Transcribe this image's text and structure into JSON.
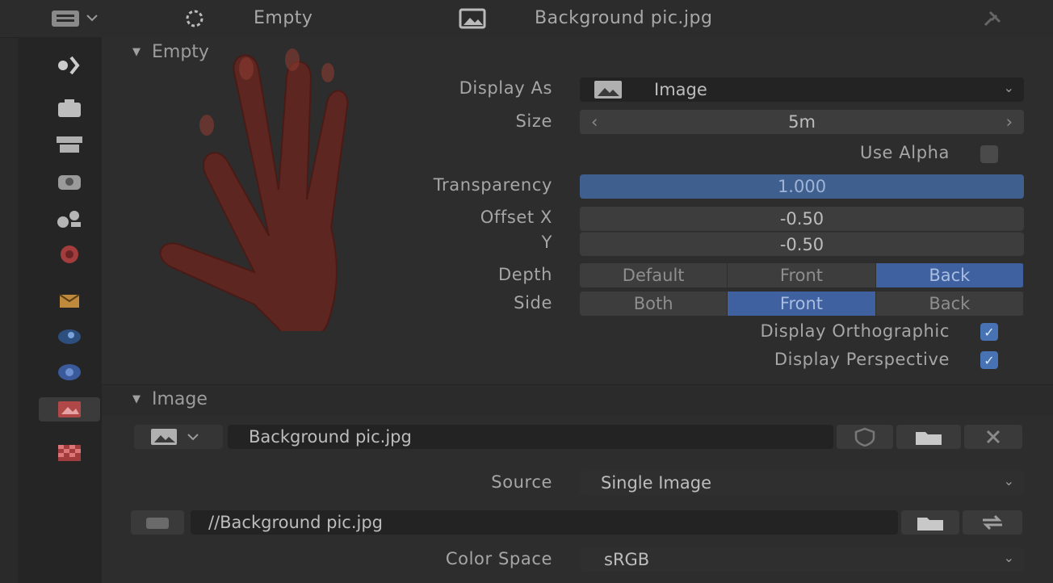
{
  "header": {
    "object_name": "Empty",
    "data_name": "Background pic.jpg"
  },
  "sidebar": {
    "icons": [
      "tool-icon",
      "render-icon",
      "output-icon",
      "view-layer-icon",
      "scene-icon",
      "world-icon",
      "object-icon",
      "modifier-icon",
      "physics-icon",
      "constraints-icon",
      "object-data-icon",
      "texture-icon"
    ],
    "active": "object-data-icon"
  },
  "empty_section": {
    "title": "Empty",
    "display_as": {
      "label": "Display As",
      "value": "Image"
    },
    "size": {
      "label": "Size",
      "value": "5m"
    },
    "use_alpha": {
      "label": "Use Alpha",
      "checked": false
    },
    "transparency": {
      "label": "Transparency",
      "value": "1.000"
    },
    "offset_x": {
      "label": "Offset X",
      "value": "-0.50"
    },
    "offset_y": {
      "label": "Y",
      "value": "-0.50"
    },
    "depth": {
      "label": "Depth",
      "options": [
        "Default",
        "Front",
        "Back"
      ],
      "selected": "Back"
    },
    "side": {
      "label": "Side",
      "options": [
        "Both",
        "Front",
        "Back"
      ],
      "selected": "Front"
    },
    "display_orthographic": {
      "label": "Display Orthographic",
      "checked": true
    },
    "display_perspective": {
      "label": "Display Perspective",
      "checked": true
    }
  },
  "image_section": {
    "title": "Image",
    "image_name": "Background pic.jpg",
    "source": {
      "label": "Source",
      "value": "Single Image"
    },
    "filepath": "//Background pic.jpg",
    "color_space": {
      "label": "Color Space",
      "value": "sRGB"
    }
  },
  "colors": {
    "accent_blue": "#4772b3",
    "panel_bg": "#2d2d2d",
    "hand": "#6b2a22"
  }
}
